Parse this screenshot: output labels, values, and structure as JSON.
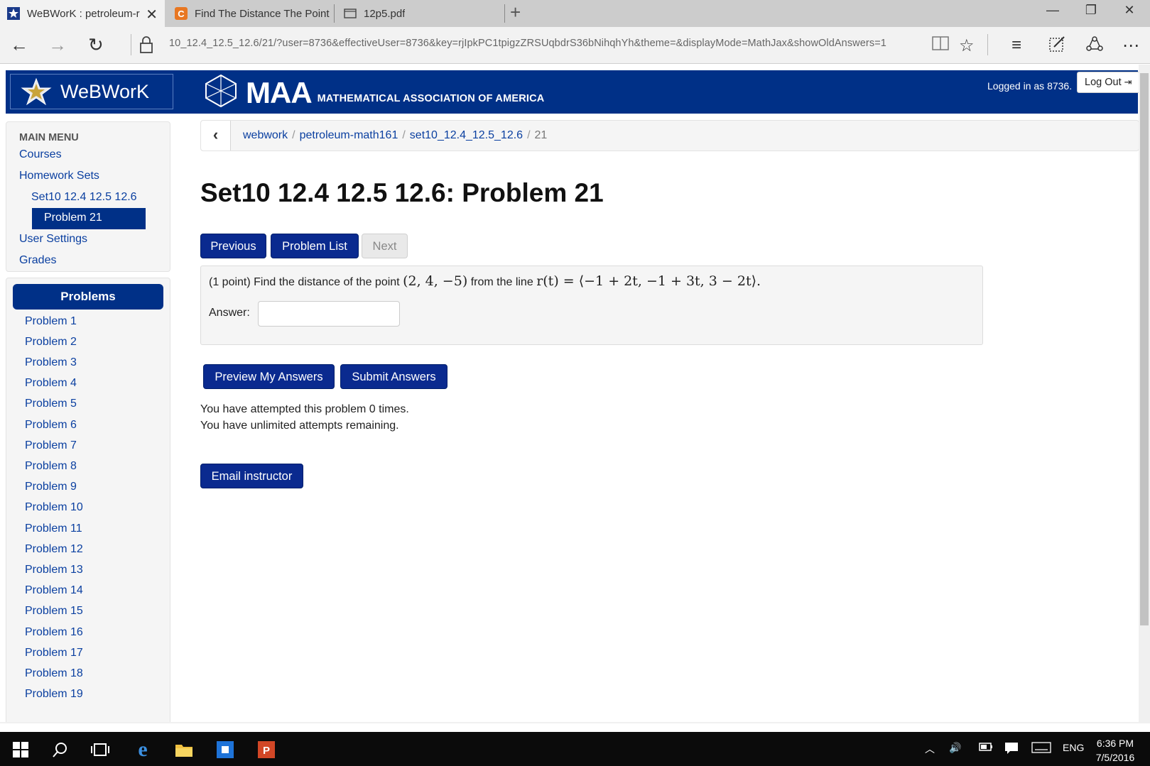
{
  "browser": {
    "tabs": [
      {
        "label": "WeBWorK : petroleum-r",
        "active": true
      },
      {
        "label": "Find The Distance The Point",
        "active": false
      },
      {
        "label": "12p5.pdf",
        "active": false
      }
    ],
    "url": "10_12.4_12.5_12.6/21/?user=8736&effectiveUser=8736&key=rjIpkPC1tpigzZRSUqbdrS36bNihqhYh&theme=&displayMode=MathJax&showOldAnswers=1"
  },
  "header": {
    "app_title": "WeBWorK",
    "org_short": "MAA",
    "org_long": "MATHEMATICAL ASSOCIATION OF AMERICA",
    "logged_in": "Logged in as 8736.",
    "logout_label": "Log Out"
  },
  "sidebar": {
    "menu_title": "MAIN MENU",
    "courses": "Courses",
    "homework_sets": "Homework Sets",
    "current_set": "Set10 12.4 12.5 12.6",
    "current_problem": "Problem 21",
    "user_settings": "User Settings",
    "grades": "Grades",
    "problems_title": "Problems",
    "problems": [
      "Problem 1",
      "Problem 2",
      "Problem 3",
      "Problem 4",
      "Problem 5",
      "Problem 6",
      "Problem 7",
      "Problem 8",
      "Problem 9",
      "Problem 10",
      "Problem 11",
      "Problem 12",
      "Problem 13",
      "Problem 14",
      "Problem 15",
      "Problem 16",
      "Problem 17",
      "Problem 18",
      "Problem 19"
    ]
  },
  "breadcrumb": {
    "items": [
      "webwork",
      "petroleum-math161",
      "set10_12.4_12.5_12.6"
    ],
    "current": "21"
  },
  "main": {
    "title": "Set10 12.4 12.5 12.6: Problem 21",
    "nav": {
      "previous": "Previous",
      "problem_list": "Problem List",
      "next": "Next"
    },
    "problem_prefix": "(1 point) Find the distance of the point",
    "point_math": "(2, 4, −5)",
    "problem_middle": "from the line",
    "line_math": "r(t) = ⟨−1 + 2t, −1 + 3t, 3 − 2t⟩.",
    "answer_label": "Answer:",
    "answer_value": "",
    "preview_label": "Preview My Answers",
    "submit_label": "Submit Answers",
    "attempts_line1": "You have attempted this problem 0 times.",
    "attempts_line2": "You have unlimited attempts remaining.",
    "email_label": "Email instructor"
  },
  "taskbar": {
    "lang": "ENG",
    "time": "6:36 PM",
    "date": "7/5/2016"
  },
  "colors": {
    "brand_navy": "#003087",
    "button_blue": "#0a2a8f",
    "link_blue": "#0a3fa0"
  }
}
